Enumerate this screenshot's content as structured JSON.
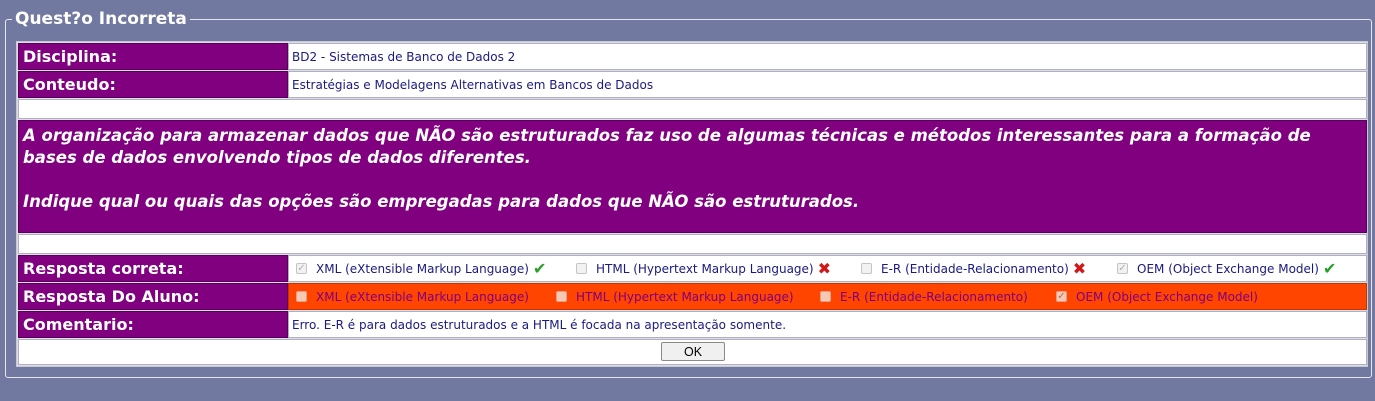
{
  "legend": "Quest?o Incorreta",
  "rows": {
    "disciplina": {
      "label": "Disciplina:",
      "value": "BD2 - Sistemas de Banco de Dados 2"
    },
    "conteudo": {
      "label": "Conteudo:",
      "value": "Estratégias e Modelagens Alternativas em Bancos de Dados"
    },
    "comentario": {
      "label": "Comentario:",
      "value": "Erro. E-R é para dados estruturados e a HTML é focada na apresentação somente."
    }
  },
  "question": {
    "paragraph1": "A organização para armazenar dados que NÃO são estruturados faz uso de algumas técnicas e métodos interessantes para a formação de bases de dados envolvendo tipos de dados diferentes.",
    "paragraph2": "Indique  qual ou quais das opções são empregadas para dados que NÃO são estruturados."
  },
  "correct": {
    "label": "Resposta correta:",
    "options": [
      {
        "text": "XML (eXtensible Markup Language)",
        "checked": true,
        "mark": "check"
      },
      {
        "text": "HTML (Hypertext Markup Language)",
        "checked": false,
        "mark": "cross"
      },
      {
        "text": "E-R (Entidade-Relacionamento)",
        "checked": false,
        "mark": "cross"
      },
      {
        "text": "OEM (Object Exchange Model)",
        "checked": true,
        "mark": "check"
      }
    ]
  },
  "student": {
    "label": "Resposta Do Aluno:",
    "options": [
      {
        "text": "XML (eXtensible Markup Language)",
        "checked": false
      },
      {
        "text": "HTML (Hypertext Markup Language)",
        "checked": false
      },
      {
        "text": "E-R (Entidade-Relacionamento)",
        "checked": false
      },
      {
        "text": "OEM (Object Exchange Model)",
        "checked": true
      }
    ]
  },
  "ok_button": "OK",
  "colors": {
    "page_bg": "#7279a0",
    "label_bg": "#800080",
    "student_row_bg": "#ff4500",
    "check_green": "#28a028",
    "cross_red": "#d01818"
  }
}
